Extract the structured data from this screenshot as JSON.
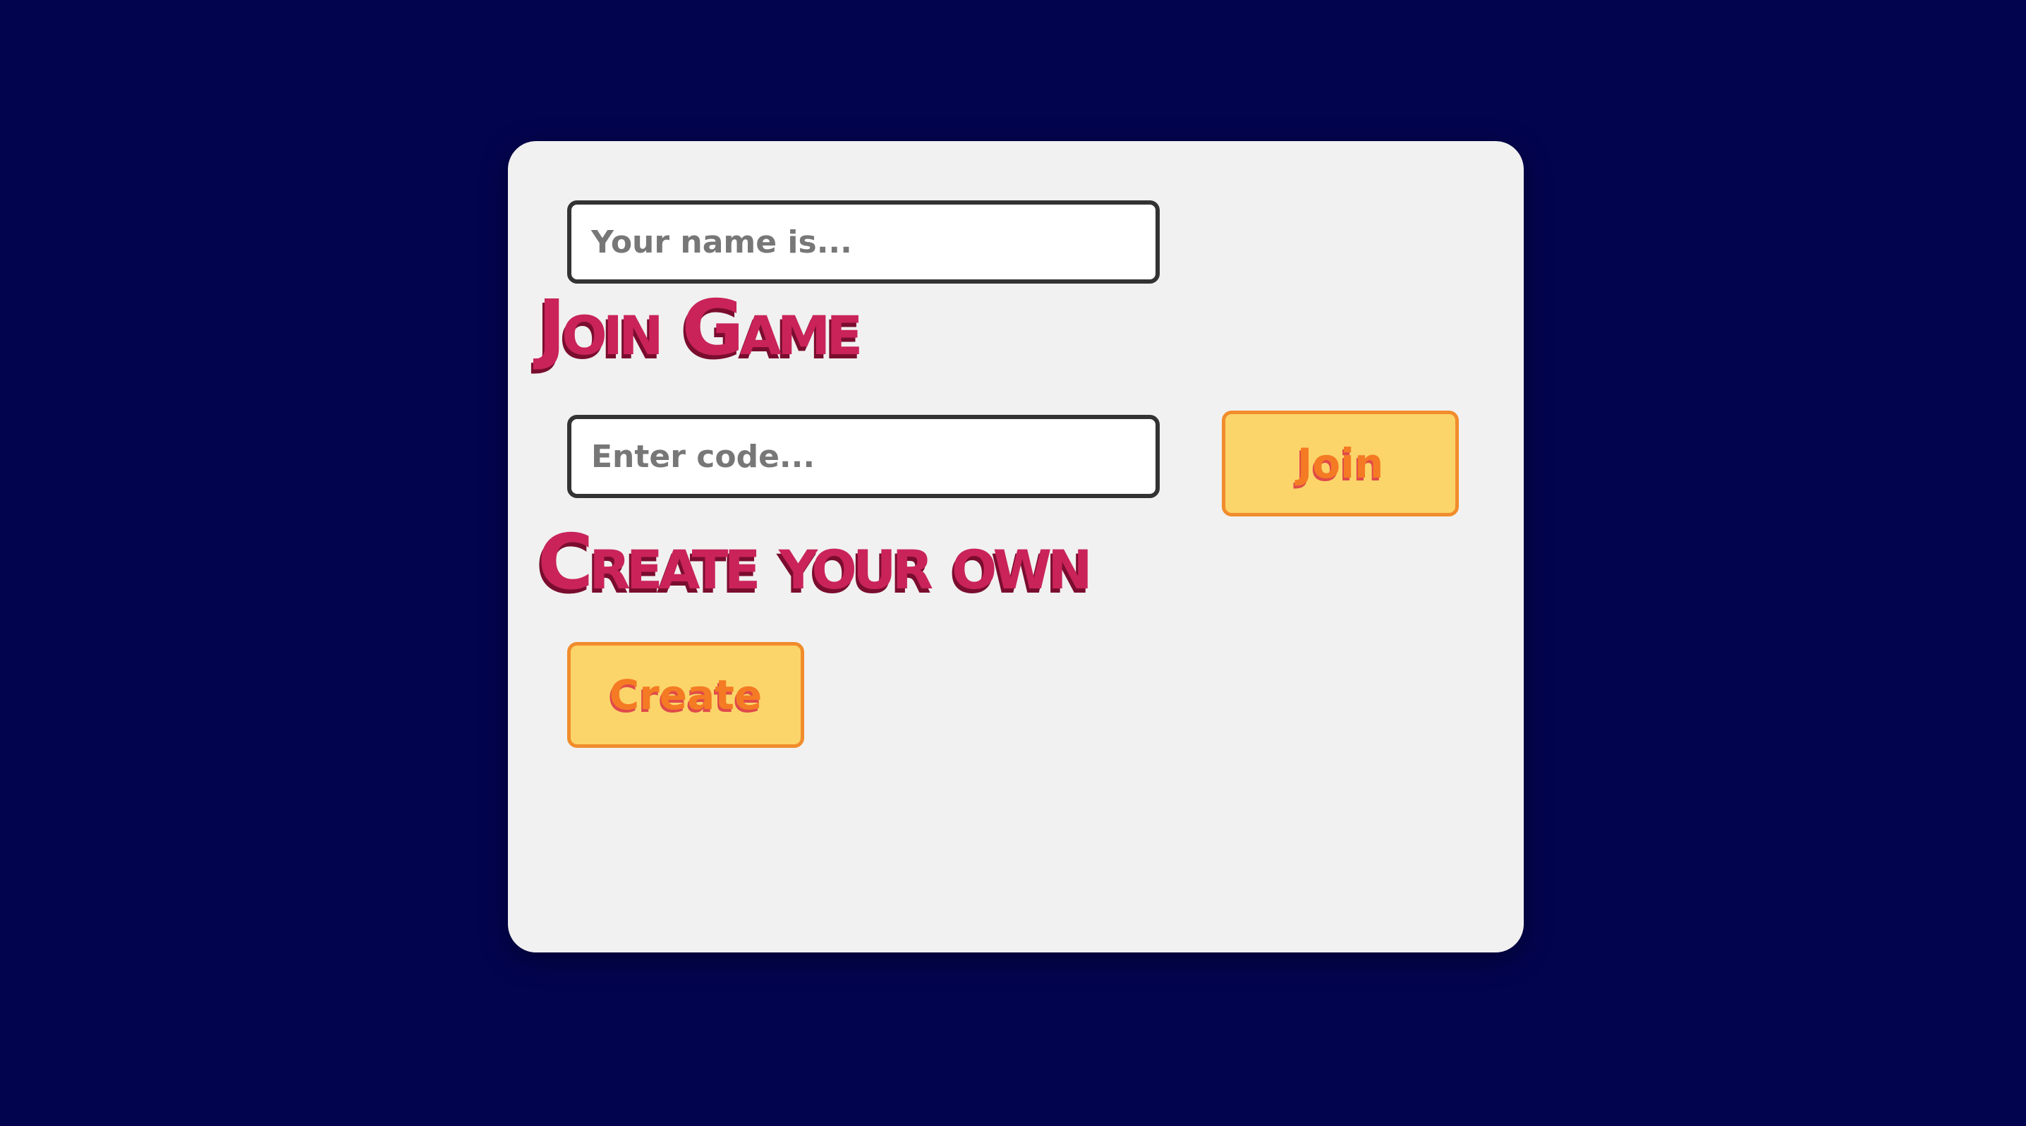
{
  "name_field": {
    "placeholder": "Your name is..."
  },
  "join_section": {
    "heading": "Join Game",
    "code_placeholder": "Enter code...",
    "button_label": "Join"
  },
  "create_section": {
    "heading": "Create your own",
    "button_label": "Create"
  },
  "colors": {
    "background": "#03044e",
    "card": "#f1f1f1",
    "heading": "#c9235a",
    "button_fill": "#fbd56a",
    "button_border": "#f18c2c",
    "button_text": "#f47b23"
  }
}
